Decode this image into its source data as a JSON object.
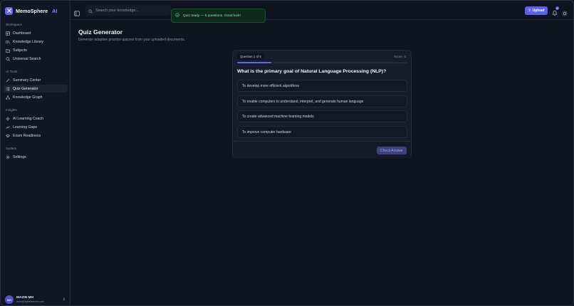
{
  "app": {
    "name": "MemoSphere",
    "name_accent": "AI"
  },
  "sidebar": {
    "sections": [
      {
        "label": "Workspace"
      },
      {
        "label": "AI Tools"
      },
      {
        "label": "Insights"
      },
      {
        "label": "System"
      }
    ],
    "items": [
      {
        "label": "Dashboard",
        "icon": "dashboard-icon"
      },
      {
        "label": "Knowledge Library",
        "icon": "library-icon"
      },
      {
        "label": "Subjects",
        "icon": "folder-icon"
      },
      {
        "label": "Universal Search",
        "icon": "search-icon"
      },
      {
        "label": "Summary Center",
        "icon": "wand-icon"
      },
      {
        "label": "Quiz Generator",
        "icon": "quiz-icon",
        "active": true
      },
      {
        "label": "Knowledge Graph",
        "icon": "graph-icon"
      },
      {
        "label": "AI Learning Coach",
        "icon": "sparkle-icon"
      },
      {
        "label": "Learning Gaps",
        "icon": "trend-icon"
      },
      {
        "label": "Exam Readiness",
        "icon": "graduation-cap-icon"
      },
      {
        "label": "Settings",
        "icon": "gear-icon"
      }
    ],
    "user": {
      "initials": "MH",
      "name": "MAZIN MH",
      "email": "mzn@3@fshmore.com"
    }
  },
  "topbar": {
    "search_placeholder": "Search your knowledge...",
    "toast": "Quiz ready — 5 questions. Good luck!",
    "upload_label": "Upload",
    "notification_count": "9"
  },
  "page": {
    "title": "Quiz Generator",
    "subtitle": "Generate adaptive practice quizzes from your uploaded documents."
  },
  "quiz": {
    "progress_label": "Question 1 of 5",
    "score_label": "Score: 0",
    "progress_fraction": 0.2,
    "question": "What is the primary goal of Natural Language Processing (NLP)?",
    "options": [
      "To develop more efficient algorithms",
      "To enable computers to understand, interpret, and generate human language",
      "To create advanced machine learning models",
      "To improve computer hardware"
    ],
    "check_label": "Check Answer"
  },
  "colors": {
    "accent": "#6366f1",
    "background": "#0e1320",
    "success": "#86efac"
  }
}
